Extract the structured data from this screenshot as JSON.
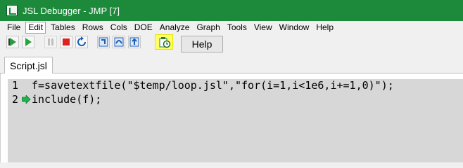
{
  "window": {
    "title": "JSL Debugger - JMP [7]"
  },
  "menu": [
    {
      "label": "File"
    },
    {
      "label": "Edit"
    },
    {
      "label": "Tables"
    },
    {
      "label": "Rows"
    },
    {
      "label": "Cols"
    },
    {
      "label": "DOE"
    },
    {
      "label": "Analyze"
    },
    {
      "label": "Graph"
    },
    {
      "label": "Tools"
    },
    {
      "label": "View"
    },
    {
      "label": "Window"
    },
    {
      "label": "Help"
    }
  ],
  "toolbar": {
    "help_label": "Help"
  },
  "tabs": [
    {
      "label": "Script.jsl"
    }
  ],
  "editor": {
    "lines": [
      {
        "number": "1",
        "code": "f=savetextfile(\"$temp/loop.jsl\",\"for(i=1,i<1e6,i+=1,0)\");"
      },
      {
        "number": "2",
        "code": "include(f);"
      }
    ]
  },
  "colors": {
    "titlebar": "#1d8a3b",
    "highlight": "#ffff66",
    "arrow": "#22b14c"
  }
}
